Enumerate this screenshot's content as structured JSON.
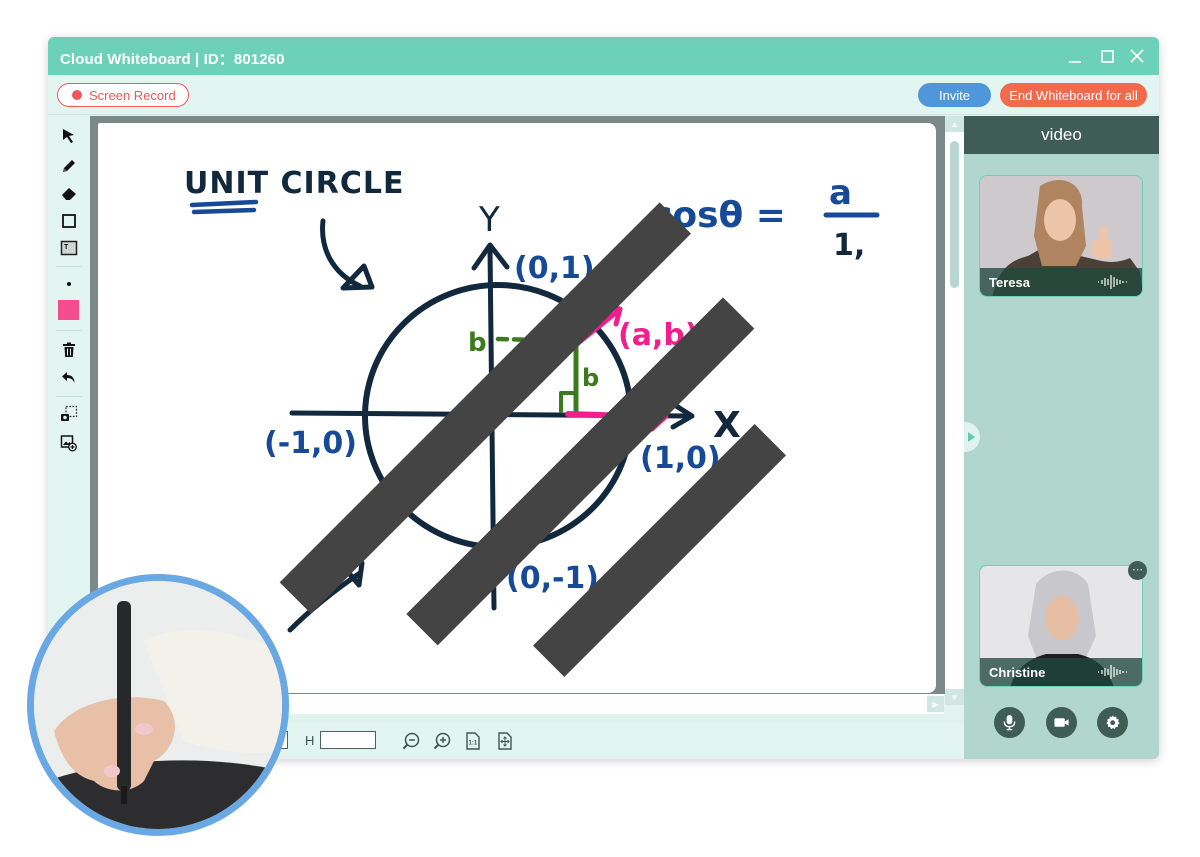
{
  "window": {
    "title": "Cloud Whiteboard  |  ID：801260",
    "controls": [
      "minimize",
      "maximize",
      "close"
    ]
  },
  "toolbar": {
    "screen_record_label": "Screen Record",
    "invite_label": "Invite",
    "end_label": "End Whiteboard for all"
  },
  "tools": [
    {
      "name": "select",
      "icon": "cursor-arrow-icon"
    },
    {
      "name": "pen",
      "icon": "pencil-icon"
    },
    {
      "name": "eraser",
      "icon": "eraser-icon"
    },
    {
      "name": "rectangle",
      "icon": "rectangle-icon"
    },
    {
      "name": "text",
      "icon": "text-box-icon"
    },
    {
      "name": "stroke-size",
      "icon": "dot-icon"
    },
    {
      "name": "color",
      "icon": "color-swatch",
      "value": "#f54c8e"
    },
    {
      "name": "delete",
      "icon": "trash-icon"
    },
    {
      "name": "undo",
      "icon": "undo-icon"
    },
    {
      "name": "screenshot",
      "icon": "screenshot-icon"
    },
    {
      "name": "insert-image",
      "icon": "add-image-icon"
    }
  ],
  "whiteboard": {
    "title_text": "UNIT CIRCLE",
    "formula": {
      "lhs": "cosθ =",
      "numerator": "a",
      "denominator": "1,"
    },
    "axis_labels": {
      "x": "X",
      "y": "Y"
    },
    "points": {
      "top": "(0,1)",
      "bottom": "(0,-1)",
      "left": "(-1,0)",
      "right": "(1,0)",
      "on_circle": "(a,b)"
    },
    "side_labels": {
      "horizontal": "b",
      "vertical": "b"
    },
    "colors": {
      "ink": "#12283d",
      "blue": "#164a96",
      "pink": "#f21e8e",
      "green": "#3c7a1e"
    }
  },
  "bottom_bar": {
    "h_label": "H",
    "h_value": "",
    "icons": [
      "zoom-out-icon",
      "zoom-in-icon",
      "actual-size-icon",
      "fit-page-icon"
    ]
  },
  "side_panel": {
    "header": "video",
    "participants": [
      {
        "name": "Teresa"
      },
      {
        "name": "Christine"
      }
    ],
    "controls": [
      "microphone-icon",
      "camera-icon",
      "settings-icon"
    ]
  },
  "colors": {
    "titlebar": "#6dd1ba",
    "panel": "#b1d6cd",
    "panel_header": "#3f5c55",
    "invite": "#4e97da",
    "end": "#f16a4c",
    "record": "#f0575a",
    "photo_ring": "#6aa8e4"
  }
}
